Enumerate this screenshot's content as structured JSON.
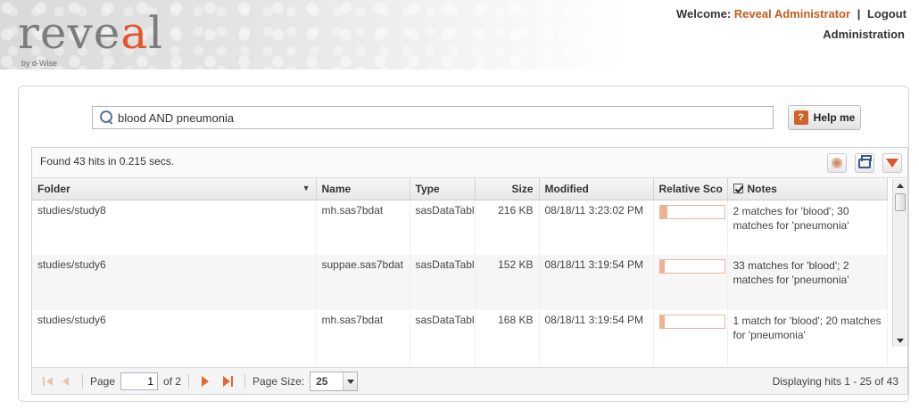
{
  "header": {
    "logo_prefix": "reve",
    "logo_accent": "a",
    "logo_suffix": "l",
    "logo_sub": "by d-Wise",
    "welcome_label": "Welcome:",
    "user_name": "Reveal Administrator",
    "separator": "|",
    "logout_label": "Logout",
    "admin_label": "Administration"
  },
  "search": {
    "query": "blood AND pneumonia",
    "help_label": "Help me",
    "help_icon_glyph": "?"
  },
  "results": {
    "found_text": "Found 43 hits in 0.215 secs.",
    "columns": [
      "Folder",
      "Name",
      "Type",
      "Size",
      "Modified",
      "Relative Sco",
      "Notes"
    ],
    "rows": [
      {
        "folder": "studies/study8",
        "name": "mh.sas7bdat",
        "type": "sasDataTable",
        "size": "216 KB",
        "modified": "08/18/11 3:23:02 PM",
        "score": 0.12,
        "notes": "2 matches for 'blood'; 30 matches for 'pneumonia'"
      },
      {
        "folder": "studies/study6",
        "name": "suppae.sas7bdat",
        "type": "sasDataTable",
        "size": "152 KB",
        "modified": "08/18/11 3:19:54 PM",
        "score": 0.07,
        "notes": "33 matches for 'blood'; 2 matches for 'pneumonia'"
      },
      {
        "folder": "studies/study6",
        "name": "mh.sas7bdat",
        "type": "sasDataTable",
        "size": "168 KB",
        "modified": "08/18/11 3:19:54 PM",
        "score": 0.07,
        "notes": "1 match for 'blood'; 20 matches for 'pneumonia'"
      }
    ]
  },
  "pager": {
    "page_label": "Page",
    "page_value": "1",
    "of_label": "of 2",
    "page_size_label": "Page Size:",
    "page_size_value": "25",
    "displaying_text": "Displaying hits 1 - 25 of 43"
  },
  "colors": {
    "accent": "#e5542b",
    "score_fill": "#f1b194",
    "link_user": "#c85a1a"
  }
}
